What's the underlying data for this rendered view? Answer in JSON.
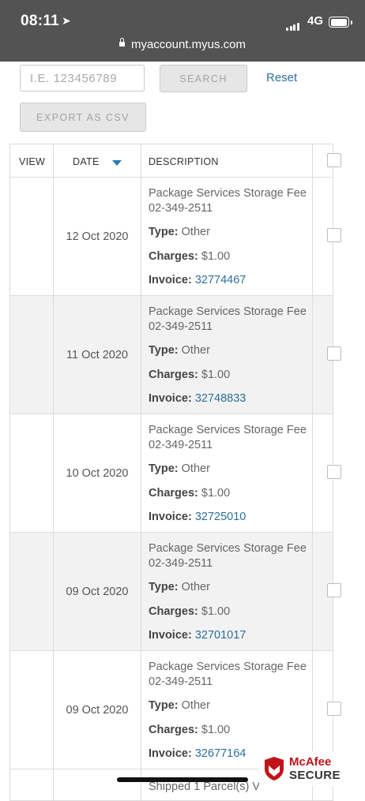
{
  "status_bar": {
    "time": "08:11",
    "network": "4G",
    "url": "myaccount.myus.com"
  },
  "search": {
    "placeholder": "I.E. 123456789",
    "search_label": "SEARCH",
    "reset_label": "Reset",
    "export_label": "EXPORT AS CSV"
  },
  "table": {
    "headers": {
      "view": "VIEW",
      "date": "DATE",
      "description": "DESCRIPTION"
    },
    "type_label": "Type:",
    "charges_label": "Charges:",
    "invoice_label": "Invoice:",
    "rows": [
      {
        "date": "12 Oct 2020",
        "description": "Package Services Storage Fee 02-349-2511",
        "type": "Other",
        "charges": "$1.00",
        "invoice": "32774467"
      },
      {
        "date": "11 Oct 2020",
        "description": "Package Services Storage Fee 02-349-2511",
        "type": "Other",
        "charges": "$1.00",
        "invoice": "32748833"
      },
      {
        "date": "10 Oct 2020",
        "description": "Package Services Storage Fee 02-349-2511",
        "type": "Other",
        "charges": "$1.00",
        "invoice": "32725010"
      },
      {
        "date": "09 Oct 2020",
        "description": "Package Services Storage Fee 02-349-2511",
        "type": "Other",
        "charges": "$1.00",
        "invoice": "32701017"
      },
      {
        "date": "09 Oct 2020",
        "description": "Package Services Storage Fee 02-349-2511",
        "type": "Other",
        "charges": "$1.00",
        "invoice": "32677164"
      }
    ],
    "partial_row_description": "Shipped 1 Parcel(s) V"
  },
  "badge": {
    "brand": "McAfee",
    "label": "SECURE"
  },
  "colors": {
    "link": "#2b6f9b",
    "sort_arrow": "#2b7bb0",
    "status_bar": "#535353",
    "mcafee_red": "#c0141a"
  }
}
